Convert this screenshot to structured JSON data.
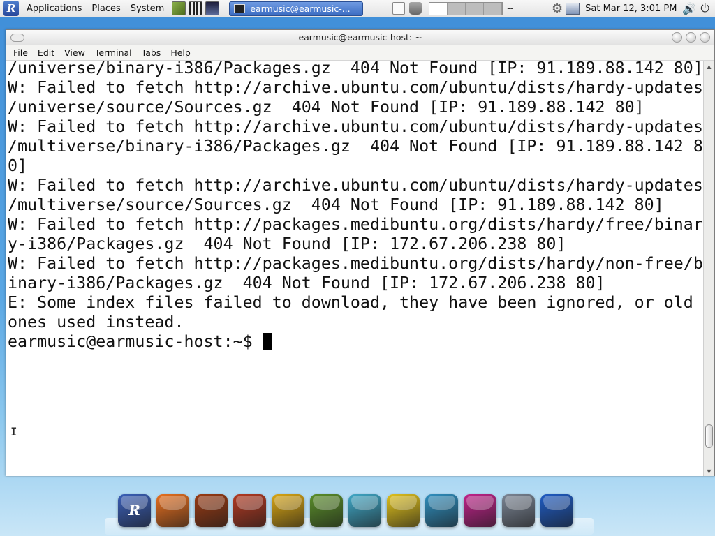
{
  "top_panel": {
    "menu_logo": "R",
    "menus": [
      "Applications",
      "Places",
      "System"
    ],
    "launchers": [
      "photo-manager-icon",
      "piano-icon",
      "music-player-icon"
    ],
    "taskbar_window_title": "earmusic@earmusic-...",
    "workspace_label": "--",
    "clock": "Sat Mar 12,  3:01 PM",
    "volume_icon": "speaker-icon",
    "power_icon": "power-icon"
  },
  "window": {
    "title": "earmusic@earmusic-host: ~",
    "menus": [
      "File",
      "Edit",
      "View",
      "Terminal",
      "Tabs",
      "Help"
    ]
  },
  "terminal": {
    "lines": [
      "/universe/binary-i386/Packages.gz  404 Not Found [IP: 91.189.88.142 80]",
      "",
      "W: Failed to fetch http://archive.ubuntu.com/ubuntu/dists/hardy-updates",
      "/universe/source/Sources.gz  404 Not Found [IP: 91.189.88.142 80]",
      "",
      "W: Failed to fetch http://archive.ubuntu.com/ubuntu/dists/hardy-updates",
      "/multiverse/binary-i386/Packages.gz  404 Not Found [IP: 91.189.88.142 8",
      "0]",
      "",
      "W: Failed to fetch http://archive.ubuntu.com/ubuntu/dists/hardy-updates",
      "/multiverse/source/Sources.gz  404 Not Found [IP: 91.189.88.142 80]",
      "",
      "W: Failed to fetch http://packages.medibuntu.org/dists/hardy/free/binar",
      "y-i386/Packages.gz  404 Not Found [IP: 172.67.206.238 80]",
      "",
      "W: Failed to fetch http://packages.medibuntu.org/dists/hardy/non-free/b",
      "inary-i386/Packages.gz  404 Not Found [IP: 172.67.206.238 80]",
      "",
      "E: Some index files failed to download, they have been ignored, or old",
      "ones used instead."
    ],
    "prompt": "earmusic@earmusic-host:~$ "
  },
  "dock": {
    "icons": [
      {
        "name": "rosa-menu-icon",
        "glyph": "R",
        "color": "#3a5fb8"
      },
      {
        "name": "firefox-icon",
        "glyph": "",
        "color": "#e8701f"
      },
      {
        "name": "guitar-icon",
        "glyph": "",
        "color": "#9a3b14"
      },
      {
        "name": "audio-app-icon",
        "glyph": "",
        "color": "#b33a22"
      },
      {
        "name": "coffee-cup-icon",
        "glyph": "",
        "color": "#d9a614"
      },
      {
        "name": "photo-editor-icon",
        "glyph": "",
        "color": "#5a8e2a"
      },
      {
        "name": "messenger-icon",
        "glyph": "",
        "color": "#3fa7c6"
      },
      {
        "name": "files-icon",
        "glyph": "",
        "color": "#e0c11c"
      },
      {
        "name": "feather-writer-icon",
        "glyph": "",
        "color": "#2f8fbf"
      },
      {
        "name": "itunes-icon",
        "glyph": "",
        "color": "#c0238a"
      },
      {
        "name": "system-settings-icon",
        "glyph": "",
        "color": "#7b8594"
      },
      {
        "name": "shutdown-icon",
        "glyph": "",
        "color": "#1f5cc4"
      }
    ]
  }
}
